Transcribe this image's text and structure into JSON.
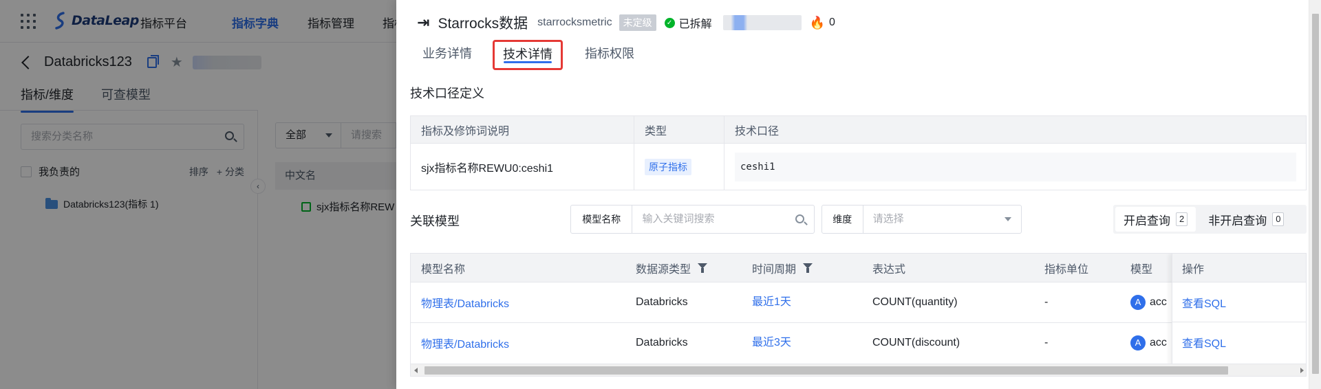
{
  "app": {
    "logo_text": "DataLeap",
    "platform": "指标平台",
    "nav": [
      {
        "label": "指标字典",
        "active": true
      },
      {
        "label": "指标管理",
        "active": false
      },
      {
        "label": "指标",
        "active": false
      }
    ]
  },
  "page": {
    "title": "Databricks123",
    "tabs": [
      "指标/维度",
      "可查模型"
    ],
    "category_search_placeholder": "搜索分类名称",
    "mine_label": "我负责的",
    "sort_label": "排序",
    "add_category_label": "+ 分类",
    "tree_item": "Databricks123(指标 1)",
    "filter_select": "全部",
    "filter_placeholder": "请搜索",
    "col_cn_name": "中文名",
    "row_name": "sjx指标名称REW"
  },
  "drawer": {
    "title": "Starrocks数据",
    "code": "starrocksmetric",
    "grade_badge": "未定级",
    "status": "已拆解",
    "hot_count": "0",
    "tabs": [
      {
        "label": "业务详情",
        "active": false
      },
      {
        "label": "技术详情",
        "active": true
      },
      {
        "label": "指标权限",
        "active": false
      }
    ],
    "definition_title": "技术口径定义",
    "definition_table": {
      "headers": [
        "指标及修饰词说明",
        "类型",
        "技术口径"
      ],
      "rows": [
        {
          "desc": "sjx指标名称REWU0:ceshi1",
          "type": "原子指标",
          "expr": "ceshi1"
        }
      ]
    },
    "related_title": "关联模型",
    "model_name_label": "模型名称",
    "model_search_placeholder": "输入关键词搜索",
    "dimension_label": "维度",
    "dimension_placeholder": "请选择",
    "query_toggle": [
      {
        "label": "开启查询",
        "count": "2",
        "active": true
      },
      {
        "label": "非开启查询",
        "count": "0",
        "active": false
      }
    ],
    "model_table": {
      "headers": [
        "模型名称",
        "数据源类型",
        "时间周期",
        "表达式",
        "指标单位",
        "模型",
        "操作"
      ],
      "rows": [
        {
          "name": "物理表/Databricks",
          "source": "Databricks",
          "period": "最近1天",
          "expr": "COUNT(quantity)",
          "unit": "-",
          "owner_initial": "A",
          "owner": "acc",
          "action": "查看SQL"
        },
        {
          "name": "物理表/Databricks",
          "source": "Databricks",
          "period": "最近3天",
          "expr": "COUNT(discount)",
          "unit": "-",
          "owner_initial": "A",
          "owner": "acc",
          "action": "查看SQL"
        }
      ]
    }
  },
  "colors": {
    "accent": "#2f6fea",
    "highlight_box": "#e53935",
    "success": "#00b42a",
    "hot": "#f53f3f"
  }
}
